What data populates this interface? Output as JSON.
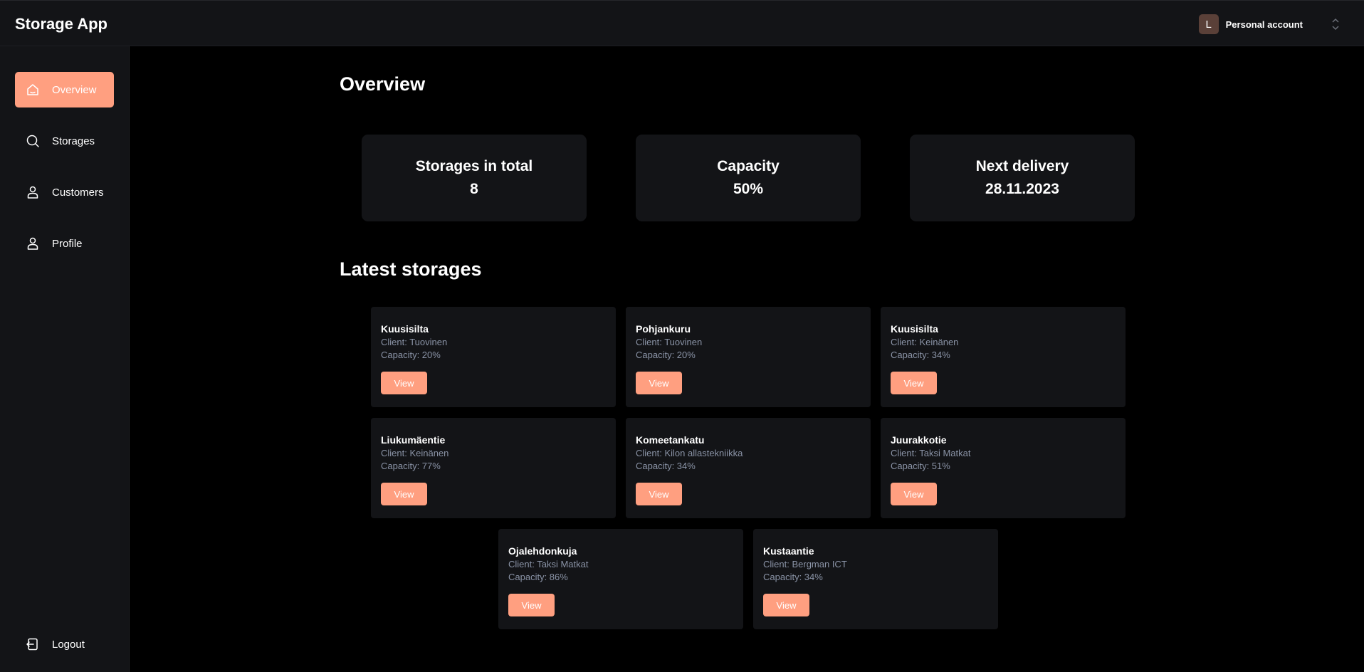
{
  "header": {
    "app_title": "Storage App",
    "account": {
      "avatar_initial": "L",
      "label": "Personal account"
    }
  },
  "sidebar": {
    "items": [
      {
        "label": "Overview",
        "icon": "home-icon",
        "active": true
      },
      {
        "label": "Storages",
        "icon": "search-icon",
        "active": false
      },
      {
        "label": "Customers",
        "icon": "user-icon",
        "active": false
      },
      {
        "label": "Profile",
        "icon": "user-icon",
        "active": false
      }
    ],
    "logout": {
      "label": "Logout",
      "icon": "logout-icon"
    }
  },
  "main": {
    "title": "Overview",
    "stats": [
      {
        "label": "Storages in total",
        "value": "8"
      },
      {
        "label": "Capacity",
        "value": "50%"
      },
      {
        "label": "Next delivery",
        "value": "28.11.2023"
      }
    ],
    "latest_title": "Latest storages",
    "storages": [
      {
        "name": "Kuusisilta",
        "client": "Client: Tuovinen",
        "capacity": "Capacity: 20%",
        "button": "View"
      },
      {
        "name": "Pohjankuru",
        "client": "Client: Tuovinen",
        "capacity": "Capacity: 20%",
        "button": "View"
      },
      {
        "name": "Kuusisilta",
        "client": "Client: Keinänen",
        "capacity": "Capacity: 34%",
        "button": "View"
      },
      {
        "name": "Liukumäentie",
        "client": "Client: Keinänen",
        "capacity": "Capacity: 77%",
        "button": "View"
      },
      {
        "name": "Komeetankatu",
        "client": "Client: Kilon allastekniikka",
        "capacity": "Capacity: 34%",
        "button": "View"
      },
      {
        "name": "Juurakkotie",
        "client": "Client: Taksi Matkat",
        "capacity": "Capacity: 51%",
        "button": "View"
      },
      {
        "name": "Ojalehdonkuja",
        "client": "Client: Taksi Matkat",
        "capacity": "Capacity: 86%",
        "button": "View"
      },
      {
        "name": "Kustaantie",
        "client": "Client: Bergman ICT",
        "capacity": "Capacity: 34%",
        "button": "View"
      }
    ]
  },
  "colors": {
    "accent": "#ff9f80",
    "panel": "#131417",
    "background": "#000000",
    "muted_text": "#8a93a6"
  }
}
